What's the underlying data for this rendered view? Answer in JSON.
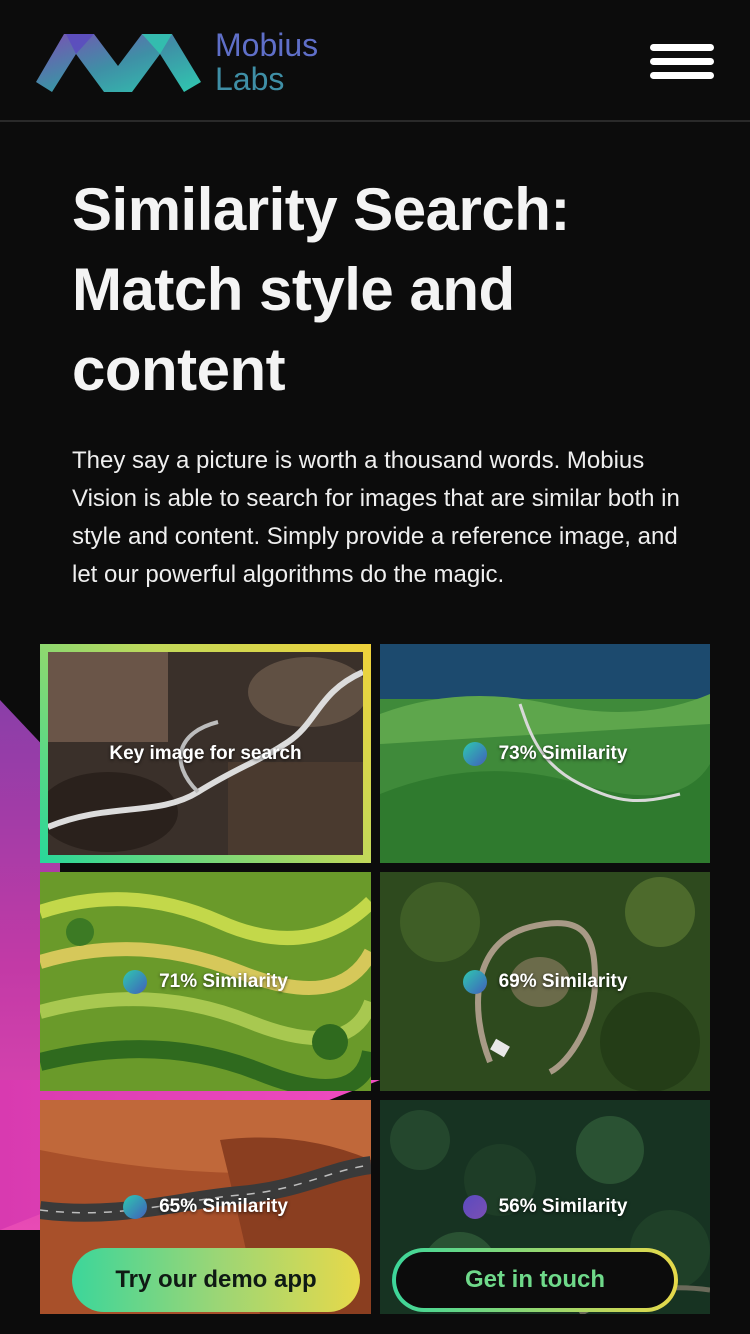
{
  "header": {
    "brand_line1": "Mobius",
    "brand_line2": "Labs"
  },
  "hero": {
    "title": "Similarity Search: Match style and content",
    "description": "They say a picture is worth a thousand words. Mobius Vision is able to search for images that are similar both in style and content. Simply provide a reference image, and let our powerful algorithms do the magic."
  },
  "gallery": {
    "key_label": "Key image for search",
    "results": [
      {
        "label": "73% Similarity",
        "similarity": 73
      },
      {
        "label": "71% Similarity",
        "similarity": 71
      },
      {
        "label": "69% Similarity",
        "similarity": 69
      },
      {
        "label": "65% Similarity",
        "similarity": 65
      },
      {
        "label": "56% Similarity",
        "similarity": 56
      }
    ]
  },
  "cta": {
    "primary_label": "Try our demo app",
    "secondary_label": "Get in touch"
  },
  "colors": {
    "background": "#0c0c0c",
    "accent_green": "#3cd69a",
    "accent_yellow": "#e7d94a",
    "accent_pink": "#e84bb5",
    "brand_purple": "#5f6fc8"
  },
  "icons": {
    "logo": "mobius-logo-icon",
    "menu": "hamburger-menu-icon",
    "similarity": "similarity-dot-icon"
  }
}
